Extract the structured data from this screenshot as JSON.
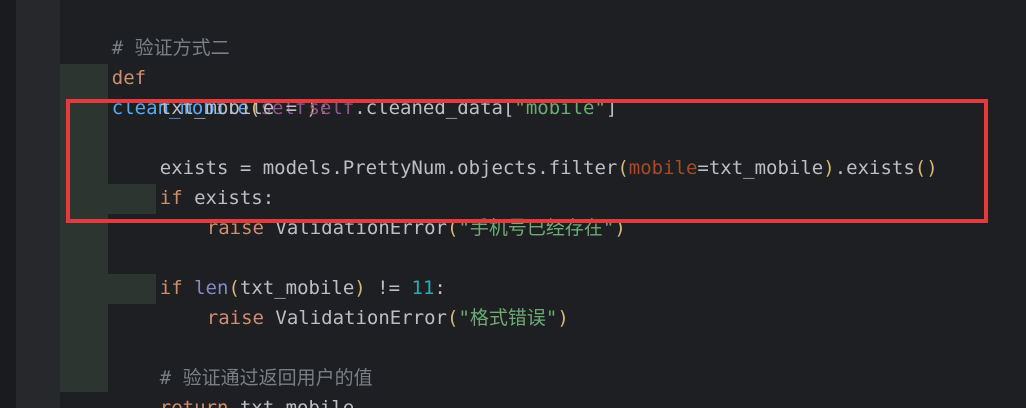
{
  "code": {
    "comment1": "# 验证方式二",
    "kw_def": "def",
    "fn_name": "clean_mobile",
    "paren_open": "(",
    "self_kw": "self",
    "paren_close_colon": "):",
    "line2_var": "txt_mobile = ",
    "line2_self": "self",
    "line2_rest": ".cleaned_data[",
    "line2_str": "\"mobile\"",
    "line2_end": "]",
    "line3_a": "exists = models.PrettyNum.objects.filter",
    "line3_paren": "(",
    "line3_param": "mobile",
    "line3_mid": "=txt_mobile",
    "line3_paren_close": ")",
    "line3_b": ".exists",
    "line3_call": "()",
    "kw_if": "if",
    "line4_rest": " exists:",
    "kw_raise": "raise",
    "err_class": " ValidationError",
    "err_paren_open": "(",
    "err_msg1": "\"手机号已经存在\"",
    "err_paren_close": ")",
    "len_builtin": "len",
    "len_arg": "txt_mobile",
    "len_ne": " != ",
    "len_num": "11",
    "len_colon": ":",
    "err_msg2": "\"格式错误\"",
    "comment2": "# 验证通过返回用户的值",
    "kw_return": "return",
    "return_val": " txt_mobile"
  },
  "colors": {
    "highlight_box": "#e33a3e"
  }
}
